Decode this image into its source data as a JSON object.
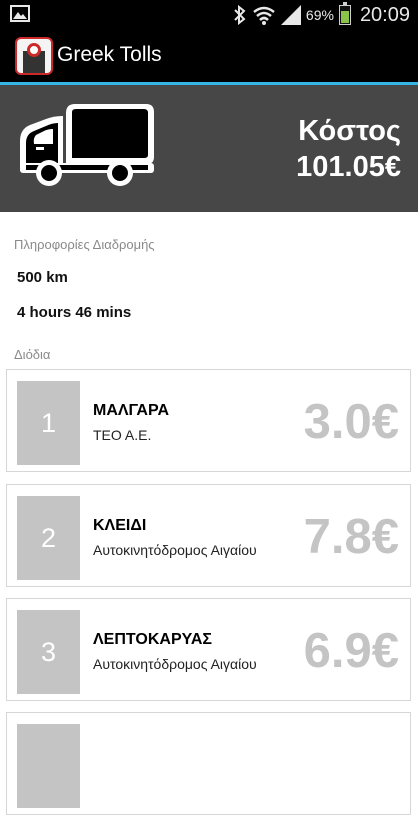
{
  "status_bar": {
    "battery_percent": "69%",
    "time": "20:09",
    "icons": [
      "gallery-notification-icon",
      "bluetooth-icon",
      "wifi-icon",
      "cell-signal-icon",
      "battery-icon"
    ],
    "battery_level": 0.69,
    "battery_color": "#8bc34a"
  },
  "app": {
    "title": "Greek Tolls",
    "accent_color": "#33b5e5"
  },
  "summary": {
    "vehicle_icon": "truck-icon",
    "cost_label": "Κόστος",
    "cost_value": "101.05€"
  },
  "route": {
    "header": "Πληροφορίες Διαδρομής",
    "distance": "500 km",
    "duration": "4 hours 46 mins"
  },
  "tolls": {
    "header": "Διόδια",
    "items": [
      {
        "number": "1",
        "name": "ΜΑΛΓΑΡΑ",
        "operator": "ΤΕΟ Α.Ε.",
        "price": "3.0€"
      },
      {
        "number": "2",
        "name": "ΚΛΕΙΔΙ",
        "operator": "Αυτοκινητόδρομος Αιγαίου",
        "price": "7.8€"
      },
      {
        "number": "3",
        "name": "ΛΕΠΤΟΚΑΡΥΑΣ",
        "operator": "Αυτοκινητόδρομος Αιγαίου",
        "price": "6.9€"
      },
      {
        "number": "",
        "name": "",
        "operator": "",
        "price": ""
      }
    ]
  }
}
